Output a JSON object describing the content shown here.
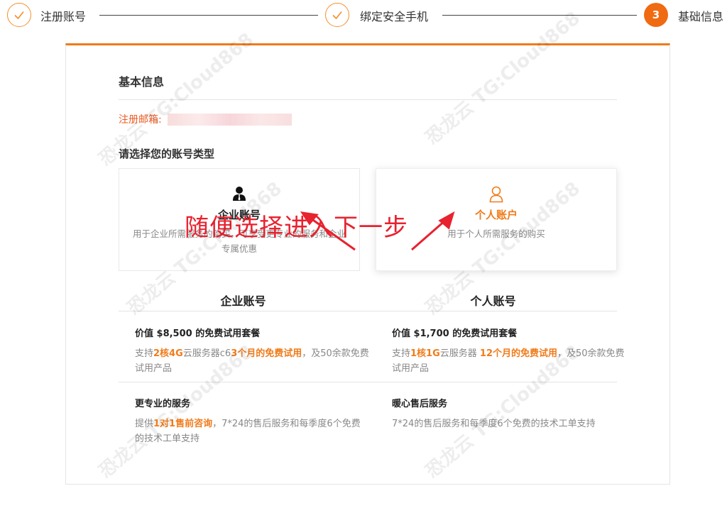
{
  "stepper": {
    "steps": [
      {
        "label": "注册账号",
        "state": "done"
      },
      {
        "label": "绑定安全手机",
        "state": "done"
      },
      {
        "label": "基础信息",
        "state": "active",
        "number": "3"
      }
    ]
  },
  "form": {
    "section_title": "基本信息",
    "email_label": "注册邮箱:",
    "account_type_title": "请选择您的账号类型"
  },
  "cards": {
    "enterprise": {
      "title": "企业账号",
      "description": "用于企业所需服务的购买，可享受更专业的服务和企业专属优惠",
      "icon": "business-user-icon"
    },
    "personal": {
      "title": "个人账户",
      "description": "用于个人所需服务的购买",
      "icon": "person-icon"
    }
  },
  "annotation": "随便选择进入下一步",
  "comparison": {
    "enterprise": {
      "heading": "企业账号",
      "trial_title": "价值 $8,500 的免费试用套餐",
      "trial_parts": [
        "支持",
        "2核4G",
        "云服务器c6",
        "3个月的免费试用",
        "，及50余款免费试用产品"
      ],
      "service_title": "更专业的服务",
      "service_parts": [
        "提供",
        "1对1售前咨询",
        "，7*24的售后服务和每季度6个免费的技术工单支持"
      ]
    },
    "personal": {
      "heading": "个人账号",
      "trial_title": "价值 $1,700 的免费试用套餐",
      "trial_parts": [
        "支持",
        "1核1G",
        "云服务器 ",
        "12个月的免费试用",
        "，及50余款免费试用产品"
      ],
      "service_title": "暖心售后服务",
      "service_desc": "7*24的售后服务和每季度6个免费的技术工单支持"
    }
  },
  "watermark": "恐龙云 TG:Cloud868",
  "colors": {
    "accent": "#f07b1a",
    "step_active": "#f06a12",
    "annotation": "#e8222f",
    "email_label": "#f05a22"
  }
}
